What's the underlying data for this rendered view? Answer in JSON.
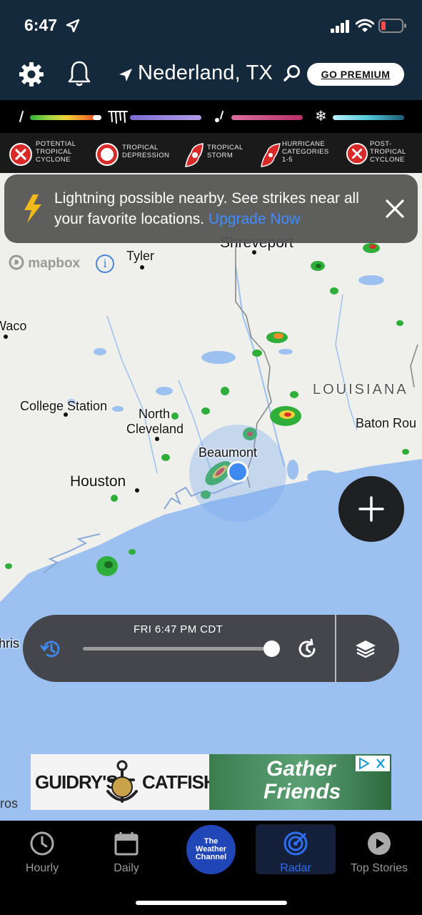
{
  "status_bar": {
    "time": "6:47"
  },
  "header": {
    "location": "Nederland, TX",
    "premium_label": "GO PREMIUM"
  },
  "tropical_legend": [
    {
      "label_l1": "POTENTIAL",
      "label_l2": "TROPICAL",
      "label_l3": "CYCLONE",
      "icon": "x-circle-icon"
    },
    {
      "label_l1": "TROPICAL",
      "label_l2": "DEPRESSION",
      "label_l3": "",
      "icon": "circle-icon"
    },
    {
      "label_l1": "TROPICAL",
      "label_l2": "STORM",
      "label_l3": "",
      "icon": "storm-icon"
    },
    {
      "label_l1": "HURRICANE",
      "label_l2": "CATEGORIES",
      "label_l3": "1-5",
      "icon": "hurricane-icon"
    },
    {
      "label_l1": "POST-",
      "label_l2": "TROPICAL",
      "label_l3": "CYCLONE",
      "icon": "x-circle-icon"
    }
  ],
  "map": {
    "attribution": "mapbox",
    "cities": {
      "shreveport": "Shreveport",
      "tyler": "Tyler",
      "waco": "Waco",
      "college_station": "College Station",
      "north_cleveland_1": "North",
      "north_cleveland_2": "Cleveland",
      "beaumont": "Beaumont",
      "houston": "Houston",
      "baton_rouge": "Baton Rou",
      "louisiana": "LOUISIANA",
      "christi": "hris",
      "ros": "ros"
    }
  },
  "banner": {
    "message": "Lightning possible nearby. See strikes near all your favorite locations.",
    "link": "Upgrade Now"
  },
  "timeline": {
    "time": "FRI 6:47 PM CDT",
    "progress": 1.0
  },
  "ad": {
    "brand_left": "GUIDRY'S",
    "brand_right": "CATFISH",
    "headline_1": "Gather",
    "headline_2": "Friends"
  },
  "nav": {
    "tabs": [
      {
        "label": "Hourly"
      },
      {
        "label": "Daily"
      },
      {
        "label": "The Weather Channel"
      },
      {
        "label": "Radar"
      },
      {
        "label": "Top Stories"
      }
    ],
    "twc_l1": "The",
    "twc_l2": "Weather",
    "twc_l3": "Channel"
  },
  "colors": {
    "accent": "#2d6df0",
    "link": "#3f8dff",
    "header_bg": "#14293b",
    "water": "#9cc1f0"
  }
}
